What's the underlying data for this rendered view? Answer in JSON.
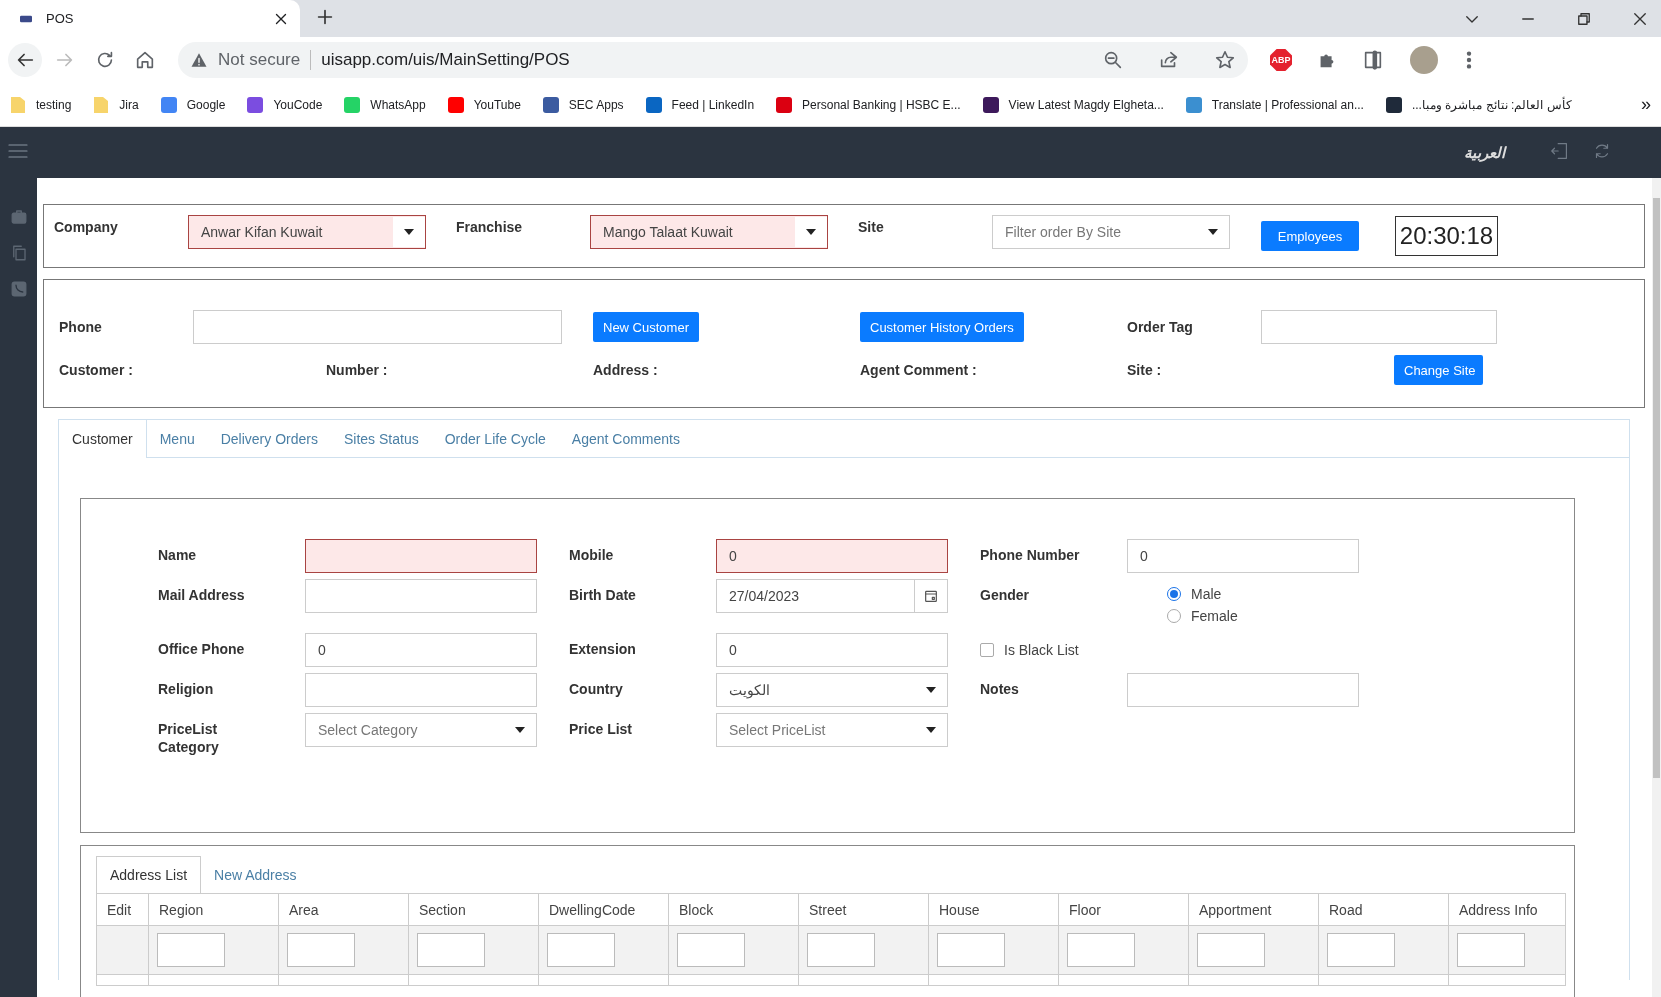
{
  "browser": {
    "tab_title": "POS",
    "security": "Not secure",
    "url": "uisapp.com/uis/MainSetting/POS",
    "extension_badge": "ABP",
    "more": "»",
    "bookmarks": [
      {
        "label": "testing",
        "kind": "folder",
        "color": "#f7d46b"
      },
      {
        "label": "Jira",
        "kind": "folder",
        "color": "#f7d46b"
      },
      {
        "label": "Google",
        "kind": "site",
        "color": "#4285f4"
      },
      {
        "label": "YouCode",
        "kind": "site",
        "color": "#7b4de0"
      },
      {
        "label": "WhatsApp",
        "kind": "site",
        "color": "#25d366"
      },
      {
        "label": "YouTube",
        "kind": "site",
        "color": "#ff0000"
      },
      {
        "label": "SEC Apps",
        "kind": "site",
        "color": "#3b5ba0"
      },
      {
        "label": "Feed | LinkedIn",
        "kind": "site",
        "color": "#0a66c2"
      },
      {
        "label": "Personal Banking | HSBC E...",
        "kind": "site",
        "color": "#db0011"
      },
      {
        "label": "View Latest Magdy Elgheta...",
        "kind": "site",
        "color": "#3d195b"
      },
      {
        "label": "Translate | Professional an...",
        "kind": "site",
        "color": "#3b8fd0"
      },
      {
        "label": "كأس العالم: نتائج مباشرة ومبا...",
        "kind": "site",
        "color": "#1f2a3a"
      }
    ]
  },
  "header": {
    "language": "العربية"
  },
  "company_bar": {
    "fields": [
      {
        "label": "Company",
        "value": "Anwar Kifan Kuwait",
        "invalid": true
      },
      {
        "label": "Franchise",
        "value": "Mango Talaat Kuwait",
        "invalid": true
      },
      {
        "label": "Site",
        "placeholder": "Filter order By Site",
        "invalid": false
      }
    ],
    "button": "Employees",
    "clock": "20:30:18"
  },
  "customer_bar": {
    "phone_label": "Phone",
    "buttons": [
      "New Customer",
      "Customer History Orders"
    ],
    "order_tag_label": "Order Tag",
    "info": [
      "Customer :",
      "Number :",
      "Address :",
      "Agent Comment :",
      "Site :"
    ],
    "change_site": "Change Site"
  },
  "tabs": [
    {
      "label": "Customer",
      "selected": true
    },
    {
      "label": "Menu",
      "selected": false
    },
    {
      "label": "Delivery Orders",
      "selected": false
    },
    {
      "label": "Sites Status",
      "selected": false
    },
    {
      "label": "Order Life Cycle",
      "selected": false
    },
    {
      "label": "Agent Comments",
      "selected": false
    }
  ],
  "form": {
    "rows": [
      [
        {
          "label": "Name",
          "kind": "text",
          "invalid": true
        },
        {
          "label": "Mobile",
          "kind": "text",
          "value": "0",
          "invalid": true
        },
        {
          "label": "Phone Number",
          "kind": "text",
          "value": "0",
          "invalid": false
        }
      ],
      [
        {
          "label": "Mail Address",
          "kind": "text",
          "invalid": false
        },
        {
          "label": "Birth Date",
          "kind": "date",
          "value": "27/04/2023",
          "invalid": false
        },
        {
          "label": "Gender",
          "kind": "radio",
          "options": [
            {
              "label": "Male",
              "selected": true
            },
            {
              "label": "Female",
              "selected": false
            }
          ]
        }
      ],
      [
        {
          "label": "Office Phone",
          "kind": "text",
          "value": "0",
          "invalid": false
        },
        {
          "label": "Extension",
          "kind": "text",
          "value": "0",
          "invalid": false
        },
        {
          "label": "Is Black List",
          "kind": "checkbox",
          "checked": false
        }
      ],
      [
        {
          "label": "Religion",
          "kind": "text",
          "invalid": false
        },
        {
          "label": "Country",
          "kind": "select",
          "value": "الكويت",
          "invalid": false
        },
        {
          "label": "Notes",
          "kind": "text",
          "invalid": false
        }
      ],
      [
        {
          "label": "PriceList Category",
          "kind": "select",
          "placeholder": "Select Category",
          "invalid": false
        },
        {
          "label": "Price List",
          "kind": "select",
          "placeholder": "Select PriceList",
          "invalid": false
        }
      ]
    ]
  },
  "address": {
    "tabs": [
      {
        "label": "Address List",
        "selected": true
      },
      {
        "label": "New Address",
        "selected": false
      }
    ],
    "columns": [
      {
        "label": "Edit",
        "filter": false
      },
      {
        "label": "Region",
        "filter": true
      },
      {
        "label": "Area",
        "filter": true
      },
      {
        "label": "Section",
        "filter": true
      },
      {
        "label": "DwellingCode",
        "filter": true
      },
      {
        "label": "Block",
        "filter": true
      },
      {
        "label": "Street",
        "filter": true
      },
      {
        "label": "House",
        "filter": true
      },
      {
        "label": "Floor",
        "filter": true
      },
      {
        "label": "Apportment",
        "filter": true
      },
      {
        "label": "Road",
        "filter": true
      },
      {
        "label": "Address Info",
        "filter": true
      }
    ]
  }
}
